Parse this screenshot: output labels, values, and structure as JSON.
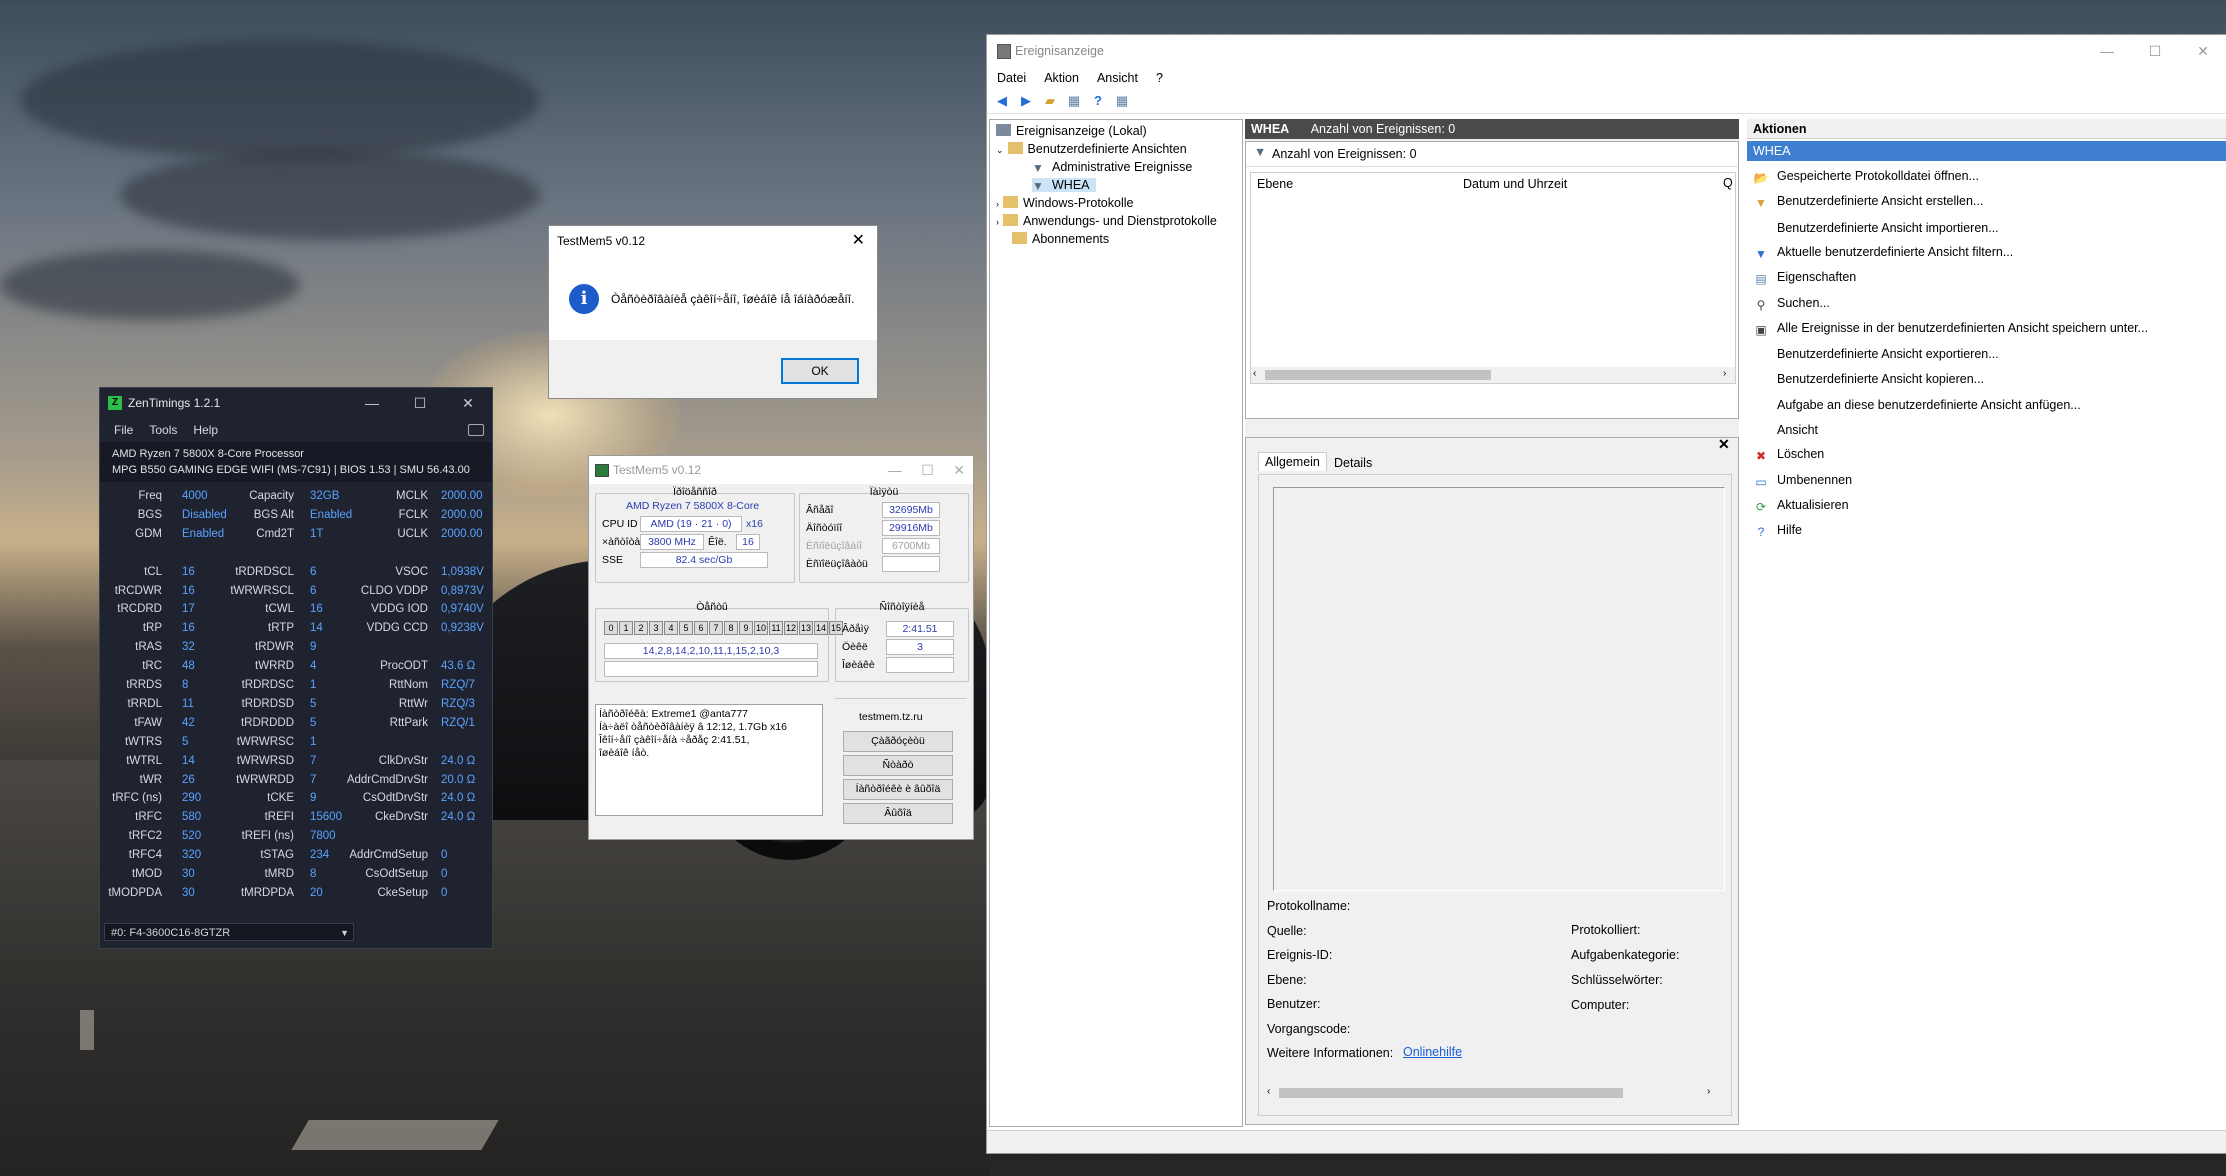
{
  "zentimings": {
    "title": "ZenTimings 1.2.1",
    "menu": [
      "File",
      "Tools",
      "Help"
    ],
    "cpu": "AMD Ryzen 7 5800X 8-Core Processor",
    "board": "MPG B550 GAMING EDGE WIFI (MS-7C91) | BIOS 1.53 | SMU 56.43.00",
    "rows": [
      {
        "l1": "Freq",
        "v1": "4000",
        "l2": "Capacity",
        "v2": "32GB",
        "l3": "MCLK",
        "v3": "2000.00"
      },
      {
        "l1": "BGS",
        "v1": "Disabled",
        "l2": "BGS Alt",
        "v2": "Enabled",
        "l3": "FCLK",
        "v3": "2000.00"
      },
      {
        "l1": "GDM",
        "v1": "Enabled",
        "l2": "Cmd2T",
        "v2": "1T",
        "l3": "UCLK",
        "v3": "2000.00"
      },
      {
        "l1": "",
        "v1": "",
        "l2": "",
        "v2": "",
        "l3": "",
        "v3": ""
      },
      {
        "l1": "tCL",
        "v1": "16",
        "l2": "tRDRDSCL",
        "v2": "6",
        "l3": "VSOC",
        "v3": "1,0938V"
      },
      {
        "l1": "tRCDWR",
        "v1": "16",
        "l2": "tWRWRSCL",
        "v2": "6",
        "l3": "CLDO VDDP",
        "v3": "0,8973V"
      },
      {
        "l1": "tRCDRD",
        "v1": "17",
        "l2": "tCWL",
        "v2": "16",
        "l3": "VDDG IOD",
        "v3": "0,9740V"
      },
      {
        "l1": "tRP",
        "v1": "16",
        "l2": "tRTP",
        "v2": "14",
        "l3": "VDDG CCD",
        "v3": "0,9238V"
      },
      {
        "l1": "tRAS",
        "v1": "32",
        "l2": "tRDWR",
        "v2": "9",
        "l3": "",
        "v3": ""
      },
      {
        "l1": "tRC",
        "v1": "48",
        "l2": "tWRRD",
        "v2": "4",
        "l3": "ProcODT",
        "v3": "43.6 Ω"
      },
      {
        "l1": "tRRDS",
        "v1": "8",
        "l2": "tRDRDSC",
        "v2": "1",
        "l3": "RttNom",
        "v3": "RZQ/7"
      },
      {
        "l1": "tRRDL",
        "v1": "11",
        "l2": "tRDRDSD",
        "v2": "5",
        "l3": "RttWr",
        "v3": "RZQ/3"
      },
      {
        "l1": "tFAW",
        "v1": "42",
        "l2": "tRDRDDD",
        "v2": "5",
        "l3": "RttPark",
        "v3": "RZQ/1"
      },
      {
        "l1": "tWTRS",
        "v1": "5",
        "l2": "tWRWRSC",
        "v2": "1",
        "l3": "",
        "v3": ""
      },
      {
        "l1": "tWTRL",
        "v1": "14",
        "l2": "tWRWRSD",
        "v2": "7",
        "l3": "ClkDrvStr",
        "v3": "24.0 Ω"
      },
      {
        "l1": "tWR",
        "v1": "26",
        "l2": "tWRWRDD",
        "v2": "7",
        "l3": "AddrCmdDrvStr",
        "v3": "20.0 Ω"
      },
      {
        "l1": "tRFC (ns)",
        "v1": "290",
        "l2": "tCKE",
        "v2": "9",
        "l3": "CsOdtDrvStr",
        "v3": "24.0 Ω"
      },
      {
        "l1": "tRFC",
        "v1": "580",
        "l2": "tREFI",
        "v2": "15600",
        "l3": "CkeDrvStr",
        "v3": "24.0 Ω"
      },
      {
        "l1": "tRFC2",
        "v1": "520",
        "l2": "tREFI (ns)",
        "v2": "7800",
        "l3": "",
        "v3": ""
      },
      {
        "l1": "tRFC4",
        "v1": "320",
        "l2": "tSTAG",
        "v2": "234",
        "l3": "AddrCmdSetup",
        "v3": "0"
      },
      {
        "l1": "tMOD",
        "v1": "30",
        "l2": "tMRD",
        "v2": "8",
        "l3": "CsOdtSetup",
        "v3": "0"
      },
      {
        "l1": "tMODPDA",
        "v1": "30",
        "l2": "tMRDPDA",
        "v2": "20",
        "l3": "CkeSetup",
        "v3": "0"
      }
    ],
    "dimm_select": "#0: F4-3600C16-8GTZR"
  },
  "dialog": {
    "title": "TestMem5 v0.12",
    "message": "Òåñòèðîâàíèå çàêîí÷åíî, îøèáîê íå îáíàðóæåíî.",
    "ok": "OK"
  },
  "testmem": {
    "title": "TestMem5 v0.12",
    "proc_group": "Ïðîöåññîð",
    "cpu_name": "AMD Ryzen 7 5800X 8-Core",
    "cpu_id_label": "CPU ID",
    "cpu_id": "AMD  (19 · 21 · 0)",
    "threads": "x16",
    "clock_label": "×àñòîòà",
    "clock": "3800 MHz",
    "thr_label": "Êîë.",
    "thr": "16",
    "sse_label": "SSE",
    "sse": "82.4 sec/Gb",
    "mem_group": "Ïàìÿòü",
    "total_label": "Âñåãî",
    "total": "32695Mb",
    "free_label": "Äîñòóïíî",
    "free": "29916Mb",
    "used_label": "Èñïîëüçîâàíî",
    "used": "6700Mb",
    "largepages_label": "Èñïîëüçîâàòü",
    "tests_group": "Òåñòû",
    "cells": [
      "0",
      "1",
      "2",
      "3",
      "4",
      "5",
      "6",
      "7",
      "8",
      "9",
      "10",
      "11",
      "12",
      "13",
      "14",
      "15"
    ],
    "sequence": "14,2,8,14,2,10,11,1,15,2,10,3",
    "status_group": "Ñîñòîÿíèå",
    "time_label": "Âðåìÿ",
    "time": "2:41.51",
    "cycle_label": "Öèêë",
    "cycle": "3",
    "errors_label": "Îøèáêè",
    "log": [
      "Íàñòðîéêà: Extreme1 @anta777",
      "Íà÷àëî òåñòèðîâàíèÿ â 12:12, 1.7Gb x16",
      "Îêîí÷åíî çàêîí÷åíà ÷åðåç 2:41.51,",
      "îøèáîê íåò."
    ],
    "site": "testmem.tz.ru",
    "buttons": [
      "Çàãðóçèòü",
      "Ñòàðò",
      "Íàñòðîéêè è âûõîä",
      "Âûõîä"
    ]
  },
  "eventviewer": {
    "title": "Ereignisanzeige",
    "menu": [
      "Datei",
      "Aktion",
      "Ansicht",
      "?"
    ],
    "tree": [
      {
        "label": "Ereignisanzeige (Lokal)",
        "indent": 0,
        "color": "#7b8a9a"
      },
      {
        "label": "Benutzerdefinierte Ansichten",
        "indent": 1,
        "color": "#e4c06a"
      },
      {
        "label": "Administrative Ereignisse",
        "indent": 2,
        "color": "#7b8a9a"
      },
      {
        "label": "WHEA",
        "indent": 2,
        "color": "#7b8a9a"
      },
      {
        "label": "Windows-Protokolle",
        "indent": 1,
        "color": "#e4c06a"
      },
      {
        "label": "Anwendungs- und Dienstprotokolle",
        "indent": 1,
        "color": "#e4c06a"
      },
      {
        "label": "Abonnements",
        "indent": 1,
        "color": "#e4c06a"
      }
    ],
    "header_name": "WHEA",
    "header_count": "Anzahl von Ereignissen: 0",
    "filter_count": "Anzahl von Ereignissen: 0",
    "col_level": "Ebene",
    "col_date": "Datum und Uhrzeit",
    "tab_general": "Allgemein",
    "tab_details": "Details",
    "fields_left": [
      "Protokollname:",
      "Quelle:",
      "Ereignis-ID:",
      "Ebene:",
      "Benutzer:",
      "Vorgangscode:",
      "Weitere Informationen:"
    ],
    "fields_right": [
      "Protokolliert:",
      "Aufgabenkategorie:",
      "Schlüsselwörter:",
      "Computer:"
    ],
    "online_help": "Onlinehilfe",
    "actions_header": "Aktionen",
    "actions_sub": "WHEA",
    "actions": [
      {
        "icon": "📂",
        "label": "Gespeicherte Protokolldatei öffnen..."
      },
      {
        "icon": "▼",
        "label": "Benutzerdefinierte Ansicht erstellen..."
      },
      {
        "icon": "",
        "label": "Benutzerdefinierte Ansicht importieren..."
      },
      {
        "icon": "▼",
        "label": "Aktuelle benutzerdefinierte Ansicht filtern..."
      },
      {
        "icon": "▤",
        "label": "Eigenschaften"
      },
      {
        "icon": "⚲",
        "label": "Suchen..."
      },
      {
        "icon": "▣",
        "label": "Alle Ereignisse in der benutzerdefinierten Ansicht speichern unter..."
      },
      {
        "icon": "",
        "label": "Benutzerdefinierte Ansicht exportieren..."
      },
      {
        "icon": "",
        "label": "Benutzerdefinierte Ansicht kopieren..."
      },
      {
        "icon": "",
        "label": "Aufgabe an diese benutzerdefinierte Ansicht anfügen..."
      },
      {
        "icon": "",
        "label": "Ansicht"
      },
      {
        "icon": "✖",
        "label": "Löschen"
      },
      {
        "icon": "▭",
        "label": "Umbenennen"
      },
      {
        "icon": "⟳",
        "label": "Aktualisieren"
      },
      {
        "icon": "?",
        "label": "Hilfe"
      }
    ]
  }
}
